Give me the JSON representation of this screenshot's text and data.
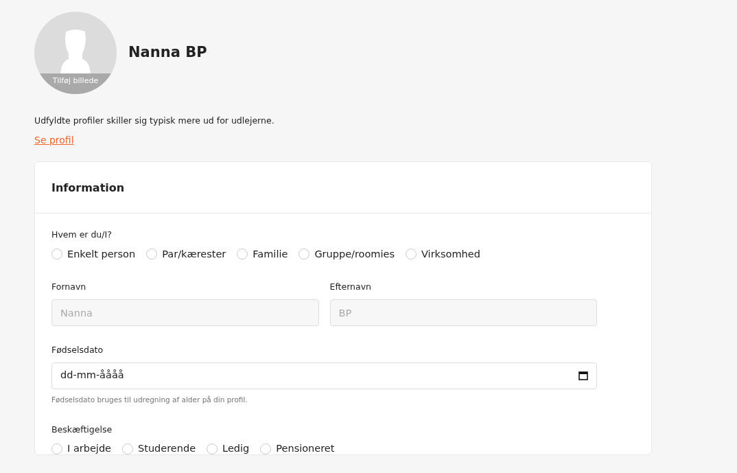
{
  "profile": {
    "avatar_label": "Tilføj billede",
    "name": "Nanna BP",
    "hint": "Udfyldte profiler skiller sig typisk mere ud for udlejerne.",
    "link": "Se profil"
  },
  "card": {
    "title": "Information",
    "who": {
      "label": "Hvem er du/I?",
      "options": [
        {
          "label": "Enkelt person",
          "selected": false
        },
        {
          "label": "Par/kærester",
          "selected": false
        },
        {
          "label": "Familie",
          "selected": false
        },
        {
          "label": "Gruppe/roomies",
          "selected": false
        },
        {
          "label": "Virksomhed",
          "selected": false
        }
      ]
    },
    "names": [
      {
        "label": "Fornavn",
        "value": "Nanna",
        "disabled": true
      },
      {
        "label": "Efternavn",
        "value": "BP",
        "disabled": true
      }
    ],
    "birthdate": {
      "label": "Fødselsdato",
      "value": "dd-mm-åååå",
      "help": "Fødselsdato bruges til udregning af alder på din profil."
    },
    "occupation": {
      "label": "Beskæftigelse",
      "options": [
        {
          "label": "I arbejde",
          "selected": false
        },
        {
          "label": "Studerende",
          "selected": false
        },
        {
          "label": "Ledig",
          "selected": false
        },
        {
          "label": "Pensioneret",
          "selected": false
        }
      ]
    }
  }
}
